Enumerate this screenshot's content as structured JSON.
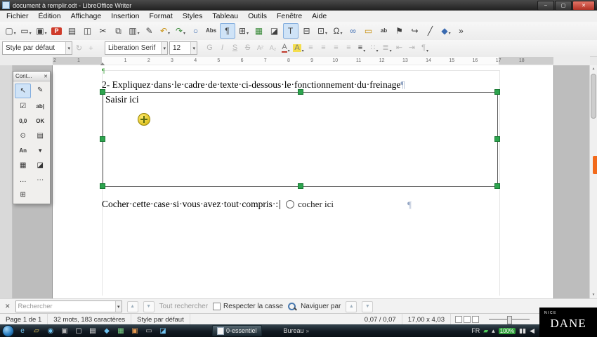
{
  "titlebar": {
    "title": "document à remplir.odt - LibreOffice Writer",
    "minimize": "–",
    "maximize": "▢",
    "close": "✕"
  },
  "menubar": [
    "Fichier",
    "Édition",
    "Affichage",
    "Insertion",
    "Format",
    "Styles",
    "Tableau",
    "Outils",
    "Fenêtre",
    "Aide"
  ],
  "toolbar_std": [
    {
      "name": "new-document-icon",
      "glyph": "▢",
      "caret": "▾"
    },
    {
      "name": "open-icon",
      "glyph": "▭",
      "caret": "▾"
    },
    {
      "name": "save-icon",
      "glyph": "▣",
      "caret": "▾"
    },
    {
      "name": "export-pdf-icon",
      "glyph": "P",
      "cls": "ic-pdf"
    },
    {
      "name": "print-icon",
      "glyph": "▤"
    },
    {
      "name": "print-preview-icon",
      "glyph": "◫"
    },
    {
      "name": "cut-icon",
      "glyph": "✂"
    },
    {
      "name": "copy-icon",
      "glyph": "⧉"
    },
    {
      "name": "paste-icon",
      "glyph": "▥",
      "caret": "▾"
    },
    {
      "name": "clone-formatting-icon",
      "glyph": "✎"
    },
    {
      "name": "undo-icon",
      "glyph": "↶",
      "cls": "ic-amber",
      "caret": "▾"
    },
    {
      "name": "redo-icon",
      "glyph": "↷",
      "cls": "ic-green",
      "caret": "▾"
    },
    {
      "name": "find-replace-icon",
      "glyph": "○",
      "cls": "ic-blue"
    },
    {
      "name": "spelling-icon",
      "glyph": "Abs",
      "cls": "ic-small"
    },
    {
      "name": "formatting-marks-icon",
      "glyph": "¶",
      "cls": "ic-active"
    },
    {
      "name": "insert-table-icon",
      "glyph": "⊞",
      "caret": "▾"
    },
    {
      "name": "insert-image-icon",
      "glyph": "▦",
      "cls": "ic-green"
    },
    {
      "name": "insert-chart-icon",
      "glyph": "◪"
    },
    {
      "name": "insert-textbox-icon",
      "glyph": "T",
      "cls": "ic-active"
    },
    {
      "name": "page-break-icon",
      "glyph": "⊟"
    },
    {
      "name": "insert-field-icon",
      "glyph": "⊡",
      "caret": "▾"
    },
    {
      "name": "special-character-icon",
      "glyph": "Ω",
      "caret": "▾"
    },
    {
      "name": "insert-hyperlink-icon",
      "glyph": "∞",
      "cls": "ic-blue"
    },
    {
      "name": "insert-comment-icon",
      "glyph": "▭",
      "cls": "ic-amber"
    },
    {
      "name": "insert-footnote-icon",
      "glyph": "ab",
      "cls": "ic-small"
    },
    {
      "name": "insert-bookmark-icon",
      "glyph": "⚑"
    },
    {
      "name": "insert-crossref-icon",
      "glyph": "↪"
    },
    {
      "name": "insert-line-icon",
      "glyph": "╱"
    },
    {
      "name": "basic-shapes-icon",
      "glyph": "◆",
      "cls": "ic-blue",
      "caret": "▾"
    },
    {
      "name": "toolbar-overflow-icon",
      "glyph": "»"
    }
  ],
  "formatting": {
    "paragraph_style": "Style par défaut",
    "font_name": "Liberation Serif",
    "font_size": "12",
    "caret": "▾",
    "update_style_icon": "↻",
    "new_style_icon": "+"
  },
  "toolbar_fmt": [
    {
      "name": "bold-icon",
      "glyph": "G",
      "cls": "dim"
    },
    {
      "name": "italic-icon",
      "glyph": "I",
      "cls": "dim-ital"
    },
    {
      "name": "underline-icon",
      "glyph": "S",
      "cls": "dim-und"
    },
    {
      "name": "strikethrough-icon",
      "glyph": "S",
      "cls": "dim-strike"
    },
    {
      "name": "superscript-icon",
      "glyph": "A²",
      "cls": "dim-sm"
    },
    {
      "name": "subscript-icon",
      "glyph": "A₂",
      "cls": "dim-sm"
    },
    {
      "name": "font-color-icon",
      "glyph": "A",
      "cls": "red-under",
      "caret": "▾"
    },
    {
      "name": "highlight-color-icon",
      "glyph": "A",
      "cls": "hl",
      "caret": "▾"
    },
    {
      "name": "align-left-icon",
      "glyph": "≡",
      "cls": "dim"
    },
    {
      "name": "align-center-icon",
      "glyph": "≡",
      "cls": "dim"
    },
    {
      "name": "align-right-icon",
      "glyph": "≡",
      "cls": "dim"
    },
    {
      "name": "justify-icon",
      "glyph": "≡",
      "cls": "dim"
    },
    {
      "name": "line-spacing-icon",
      "glyph": "≡",
      "cls": "dark",
      "caret": "▾"
    },
    {
      "name": "bullet-list-icon",
      "glyph": "∷",
      "cls": "dim",
      "caret": "▾"
    },
    {
      "name": "numbered-list-icon",
      "glyph": "≣",
      "cls": "dim",
      "caret": "▾"
    },
    {
      "name": "decrease-indent-icon",
      "glyph": "⇤",
      "cls": "dim"
    },
    {
      "name": "increase-indent-icon",
      "glyph": "⇥",
      "cls": "dim"
    },
    {
      "name": "paragraph-settings-icon",
      "glyph": "¶",
      "cls": "dim",
      "caret": "▾"
    }
  ],
  "ruler": {
    "margin_numbers": [
      "2",
      "1"
    ],
    "numbers": [
      "1",
      "2",
      "3",
      "4",
      "5",
      "6",
      "7",
      "8",
      "9",
      "10",
      "11",
      "12",
      "13",
      "14",
      "15",
      "16",
      "17",
      "18"
    ]
  },
  "form_panel": {
    "title": "Cont...",
    "close": "✕",
    "items": [
      {
        "name": "select-pointer-icon",
        "glyph": "↖",
        "cls": "fc-sel"
      },
      {
        "name": "design-mode-icon",
        "glyph": "✎"
      },
      {
        "name": "check-box-icon",
        "glyph": "☑"
      },
      {
        "name": "text-box-icon",
        "glyph": "ab|",
        "cls": "fc-sm"
      },
      {
        "name": "formatted-field-icon",
        "glyph": "0,0",
        "cls": "fc-sm"
      },
      {
        "name": "push-button-icon",
        "glyph": "OK",
        "cls": "fc-sm"
      },
      {
        "name": "option-button-icon",
        "glyph": "⊙"
      },
      {
        "name": "list-box-icon",
        "glyph": "▤"
      },
      {
        "name": "label-field-icon",
        "glyph": "An",
        "cls": "fc-sm"
      },
      {
        "name": "combo-box-icon",
        "glyph": "▼",
        "cls": "fc-sm"
      },
      {
        "name": "image-button-icon",
        "glyph": "▦"
      },
      {
        "name": "image-control-icon",
        "glyph": "◪"
      },
      {
        "name": "file-selection-icon",
        "glyph": "…"
      },
      {
        "name": "more-controls-icon",
        "glyph": "⋯"
      },
      {
        "name": "table-control-icon",
        "glyph": "⊞"
      }
    ]
  },
  "document": {
    "heading": "2- Expliquez·dans·le·cadre·de·texte·ci-dessous·le·fonctionnement·du·freinage",
    "pilcrow": "¶",
    "textbox_text": "Saisir ici",
    "checkbox_sentence": "Cocher·cette·case·si·vous·avez·tout·compris·:",
    "radio_label": "cocher ici"
  },
  "scrollbar": {
    "up": "▲",
    "down": "▼"
  },
  "findbar": {
    "close": "✕",
    "placeholder": "Rechercher",
    "caret": "▾",
    "prev": "▲",
    "next": "▼",
    "find_all": "Tout rechercher",
    "match_case": "Respecter la casse",
    "navigate_by": "Naviguer par"
  },
  "statusbar": {
    "page": "Page 1 de 1",
    "wordcount": "32 mots, 183 caractères",
    "style": "Style par défaut",
    "object_pos": "0,07 / 0,07",
    "object_size": "17,00 x 4,03"
  },
  "taskbar": {
    "apps": [
      {
        "name": "ie-icon",
        "glyph": "e",
        "cls": "tb-blue"
      },
      {
        "name": "explorer-folder-icon",
        "glyph": "▱",
        "cls": "tb-yellow"
      },
      {
        "name": "media-player-icon",
        "glyph": "◉",
        "cls": "tb-blue"
      },
      {
        "name": "taskbar-app-icon",
        "glyph": "▣",
        "cls": "tb-gray"
      },
      {
        "name": "writer-document-icon",
        "glyph": "▢",
        "cls": "tb-white"
      },
      {
        "name": "taskbar-app-icon",
        "glyph": "▤",
        "cls": "tb-white"
      },
      {
        "name": "taskbar-app-icon",
        "glyph": "◆",
        "cls": "tb-blue"
      },
      {
        "name": "taskbar-app-icon",
        "glyph": "▦",
        "cls": "tb-green"
      },
      {
        "name": "taskbar-app-icon",
        "glyph": "▣",
        "cls": "tb-orange"
      },
      {
        "name": "taskbar-app-icon",
        "glyph": "▭",
        "cls": "tb-gray"
      },
      {
        "name": "taskbar-app-icon",
        "glyph": "◪",
        "cls": "tb-blue"
      }
    ],
    "window_label": "0-essentiel",
    "deskband_label": "Bureau",
    "chevron": "»",
    "tray": [
      {
        "name": "language-indicator",
        "text": "FR"
      },
      {
        "name": "shield-icon",
        "text": "▰",
        "cls": "tr-green"
      },
      {
        "name": "hidden-icons-button",
        "text": "▴"
      },
      {
        "name": "tray-percent-badge",
        "text": "100%",
        "cls": "tr-badge"
      },
      {
        "name": "network-icon",
        "text": "▮▮"
      },
      {
        "name": "volume-icon",
        "text": "◀"
      }
    ]
  },
  "watermark": {
    "brand": "DANE",
    "sub": "NICE"
  }
}
